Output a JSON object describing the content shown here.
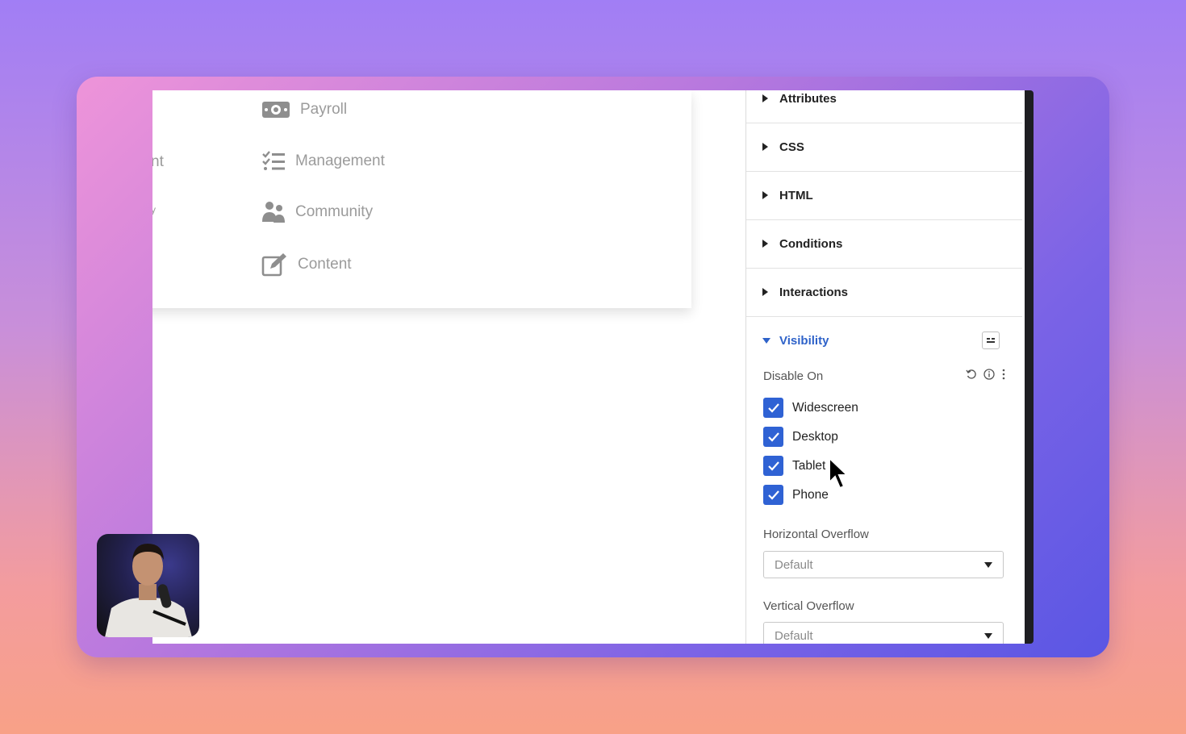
{
  "menu": {
    "cut_labels": [
      "nt",
      "y"
    ],
    "items": [
      {
        "label": "Payroll",
        "icon": "money-icon"
      },
      {
        "label": "Management",
        "icon": "checklist-icon"
      },
      {
        "label": "Community",
        "icon": "people-icon"
      },
      {
        "label": "Content",
        "icon": "edit-icon"
      }
    ]
  },
  "panel": {
    "sections": [
      {
        "label": "Attributes"
      },
      {
        "label": "CSS"
      },
      {
        "label": "HTML"
      },
      {
        "label": "Conditions"
      },
      {
        "label": "Interactions"
      }
    ],
    "visibility": {
      "label": "Visibility",
      "accent_color": "#2e62c9",
      "disable_on": {
        "label": "Disable On",
        "options": [
          {
            "label": "Widescreen",
            "checked": true
          },
          {
            "label": "Desktop",
            "checked": true
          },
          {
            "label": "Tablet",
            "checked": true
          },
          {
            "label": "Phone",
            "checked": true
          }
        ]
      },
      "horizontal_overflow": {
        "label": "Horizontal Overflow",
        "value": "Default"
      },
      "vertical_overflow": {
        "label": "Vertical Overflow",
        "value": "Default"
      }
    }
  },
  "colors": {
    "checkbox": "#2f62d4"
  }
}
